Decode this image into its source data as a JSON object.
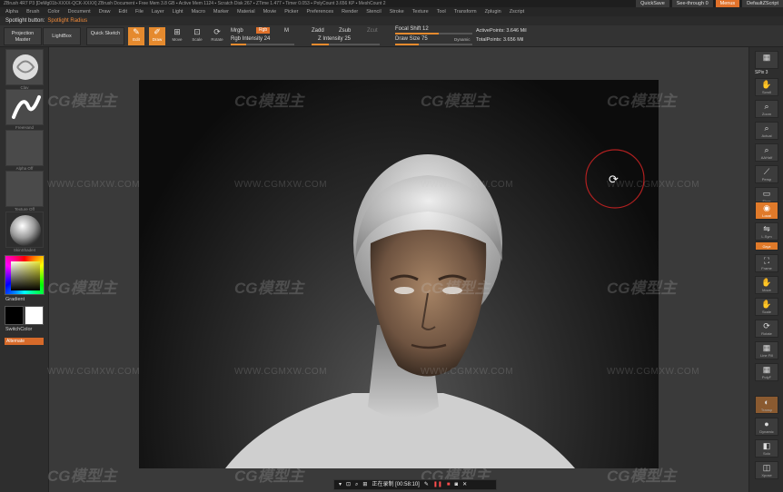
{
  "titlebar": {
    "text": "ZBrush 4R7 P3 [DeMg01b-XXXX-QCK-XXXX] ZBrush Document ▪ Free Mem 3.8 GB ▪ Active Mem 1124 ▪ Scratch Disk 267 ▪ ZTime 1.477 ▪ Timer 0.053 ▪ PolyCount 3.656 KP ▪ MeshCount 2",
    "quicksave": "QuickSave",
    "seethrough": "See-through 0",
    "menus": "Menus",
    "script": "DefaultZScript"
  },
  "menubar": [
    "Alpha",
    "Brush",
    "Color",
    "Document",
    "Draw",
    "Edit",
    "File",
    "Layer",
    "Light",
    "Macro",
    "Marker",
    "Material",
    "Movie",
    "Picker",
    "Preferences",
    "Render",
    "Stencil",
    "Stroke",
    "Texture",
    "Tool",
    "Transform",
    "Zplugin",
    "Zscript"
  ],
  "spotlight": {
    "label": "Spotlight button:",
    "value": "Spotlight Radius"
  },
  "toolbar": {
    "projection_master": "Projection Master",
    "lightbox": "LightBox",
    "quick_sketch": "Quick Sketch",
    "edit": "Edit",
    "draw": "Draw",
    "move": "Move",
    "scale": "Scale",
    "rotate": "Rotate",
    "mrgb": "Mrgb",
    "rgb": "Rgb",
    "m": "M",
    "rgb_intensity": "Rgb Intensity 24",
    "zadd": "Zadd",
    "zsub": "Zsub",
    "zcut": "Zcut",
    "z_intensity": "Z Intensity 25",
    "focal_shift": "Focal Shift 12",
    "draw_size": "Draw Size 75",
    "dynamic": "Dynamic",
    "active_points": "ActivePoints: 3.646 Mil",
    "total_points": "TotalPoints: 3.656 Mil",
    "rgb_intensity_value": 24,
    "z_intensity_value": 25,
    "focal_shift_value": 12,
    "draw_size_value": 75
  },
  "left_panel": {
    "thumb1": "Clay",
    "thumb2": "FreeHand",
    "thumb3": "Alpha Off",
    "thumb4": "Texture Off",
    "thumb5": "SkinShade4",
    "gradient": "Gradient",
    "switch_color": "SwitchColor",
    "alternate": "Alternate"
  },
  "right_panel": {
    "spix": "SPix 3",
    "scroll": "Scroll",
    "zoom": "Zoom",
    "actual": "Actual",
    "aahalf": "AAHalf",
    "persp": "Persp",
    "floor": "Floor",
    "local": "Local",
    "lsym": "L.Sym",
    "gxyz": "Gxyz",
    "frame": "Frame",
    "move": "Move",
    "scale": "Scale",
    "rotate": "Rotate",
    "linefill": "Line Fill",
    "polyf": "PolyF",
    "transp": "Transp",
    "dynamic": "Dynamic",
    "solo": "Solo",
    "xpose": "Xpose"
  },
  "watermark": {
    "brand": "CG模型主",
    "url": "WWW.CGMXW.COM"
  },
  "recorder": {
    "status": "正在录制 [00:58:10]"
  },
  "colors": {
    "accent": "#e58a2e",
    "panel": "#2e2e2e",
    "viewport_edge": "#0c0c0c"
  }
}
